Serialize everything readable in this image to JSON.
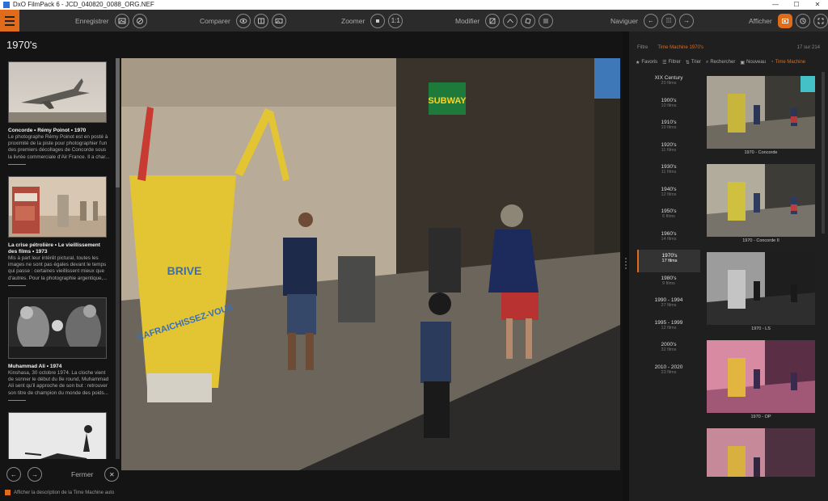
{
  "window": {
    "title": "DxO FilmPack 6 - JCD_040820_0088_ORG.NEF",
    "minimize": "—",
    "maximize": "☐",
    "close": "✕"
  },
  "toolbar": {
    "save_label": "Enregistrer",
    "compare_label": "Comparer",
    "zoom_label": "Zoomer",
    "zoom_value": "1:1",
    "edit_label": "Modifier",
    "navigate_label": "Naviguer",
    "display_label": "Afficher"
  },
  "left_panel": {
    "title": "1970's",
    "cards": [
      {
        "title": "Concorde • Rémy Poinot • 1970",
        "desc": "Le photographe Rémy Poinot est en posté à proximité de la piste pour photographier l'un des premiers décollages de Concorde sous la livrée commerciale d'Air France. Il a char..."
      },
      {
        "title": "La crise pétrolière • Le vieillissement des films • 1973",
        "desc": "Mis à part leur intérêt pictural, toutes les images ne sont pas égales devant le temps qui passe : certaines vieillissent mieux que d'autres. Pour la photographie argentique,..."
      },
      {
        "title": "Muhammad Ali • 1974",
        "desc": "Kinshasa, 30 octobre 1974. La cloche vient de sonner le début du 8e round, Muhammad Ali sent qu'il approche de son but : retrouver son titre de champion du monde des poids..."
      },
      {
        "title": "",
        "desc": ""
      }
    ],
    "close_label": "Fermer",
    "show_description_label": "Afficher la description de la Time Machine auto"
  },
  "photo": {
    "sign_text": "SUBWAY",
    "cup_text1": "BRIVE",
    "cup_text2": "RAFRAICHISSEZ-VOUS"
  },
  "right_panel": {
    "filter_label": "Filtre",
    "filter_value": "Time Machine 1970's",
    "count": "17 sur 214",
    "tools": [
      {
        "label": "Favoris",
        "icon": "★"
      },
      {
        "label": "Filtrer",
        "icon": "☰"
      },
      {
        "label": "Trier",
        "icon": "⇅"
      },
      {
        "label": "Rechercher",
        "icon": "⌕"
      },
      {
        "label": "Nouveau",
        "icon": "▣"
      },
      {
        "label": "Time Machine",
        "icon": "◔"
      }
    ],
    "decades": [
      {
        "name": "XIX Century",
        "count": "20 films"
      },
      {
        "name": "1900's",
        "count": "10 films"
      },
      {
        "name": "1910's",
        "count": "10 films"
      },
      {
        "name": "1920's",
        "count": "11 films"
      },
      {
        "name": "1930's",
        "count": "11 films"
      },
      {
        "name": "1940's",
        "count": "12 films"
      },
      {
        "name": "1950's",
        "count": "6 films"
      },
      {
        "name": "1960's",
        "count": "14 films"
      },
      {
        "name": "1970's",
        "count": "17 films"
      },
      {
        "name": "1980's",
        "count": "9 films"
      },
      {
        "name": "1990 - 1994",
        "count": "27 films"
      },
      {
        "name": "1995 - 1999",
        "count": "12 films"
      },
      {
        "name": "2000's",
        "count": "32 films"
      },
      {
        "name": "2010 - 2020",
        "count": "23 films"
      }
    ],
    "films": [
      {
        "name": "1970 - Concorde"
      },
      {
        "name": "1970 - Concorde II"
      },
      {
        "name": "1970 - LS"
      },
      {
        "name": "1970 - OP"
      },
      {
        "name": ""
      }
    ]
  },
  "colors": {
    "accent": "#e06b1a",
    "background": "#141414",
    "panel": "#1f1f1f"
  }
}
